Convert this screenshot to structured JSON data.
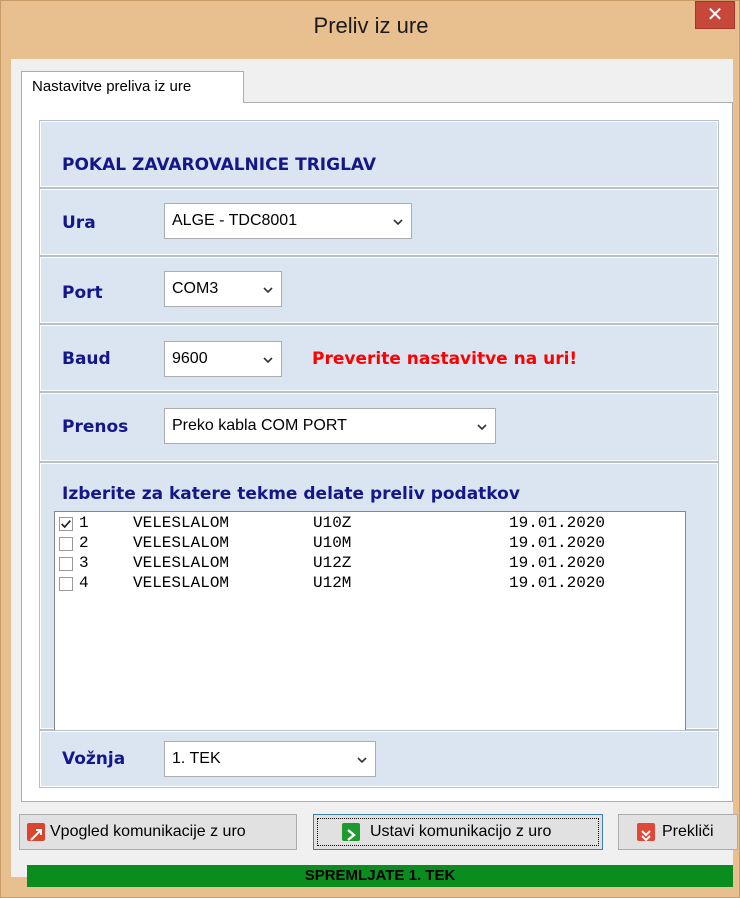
{
  "window": {
    "title": "Preliv iz ure",
    "close_label": "✕"
  },
  "tab": {
    "label": "Nastavitve preliva iz ure"
  },
  "header": {
    "title": "POKAL ZAVAROVALNICE TRIGLAV"
  },
  "fields": {
    "ura": {
      "label": "Ura",
      "value": "ALGE - TDC8001"
    },
    "port": {
      "label": "Port",
      "value": "COM3"
    },
    "baud": {
      "label": "Baud",
      "value": "9600",
      "warning": "Preverite nastavitve na uri!"
    },
    "prenos": {
      "label": "Prenos",
      "value": "Preko kabla COM PORT"
    },
    "voznja": {
      "label": "Vožnja",
      "value": "1. TEK"
    }
  },
  "races": {
    "heading": "Izberite za katere tekme delate preliv podatkov",
    "items": [
      {
        "checked": true,
        "num": "1",
        "discipline": "VELESLALOM",
        "category": "U10Z",
        "date": "19.01.2020"
      },
      {
        "checked": false,
        "num": "2",
        "discipline": "VELESLALOM",
        "category": "U10M",
        "date": "19.01.2020"
      },
      {
        "checked": false,
        "num": "3",
        "discipline": "VELESLALOM",
        "category": "U12Z",
        "date": "19.01.2020"
      },
      {
        "checked": false,
        "num": "4",
        "discipline": "VELESLALOM",
        "category": "U12M",
        "date": "19.01.2020"
      }
    ]
  },
  "buttons": {
    "view_label": "Vpogled komunikacije z uro",
    "stop_label": "Ustavi komunikacijo z uro",
    "cancel_label": "Prekliči"
  },
  "status": {
    "text": "SPREMLJATE 1. TEK"
  },
  "colors": {
    "label_blue": "#13178a",
    "warning_red": "#ff0000",
    "panel_bg": "#dbe5f1",
    "status_green": "#0b8c1f",
    "title_bar": "#e8bf8e"
  }
}
